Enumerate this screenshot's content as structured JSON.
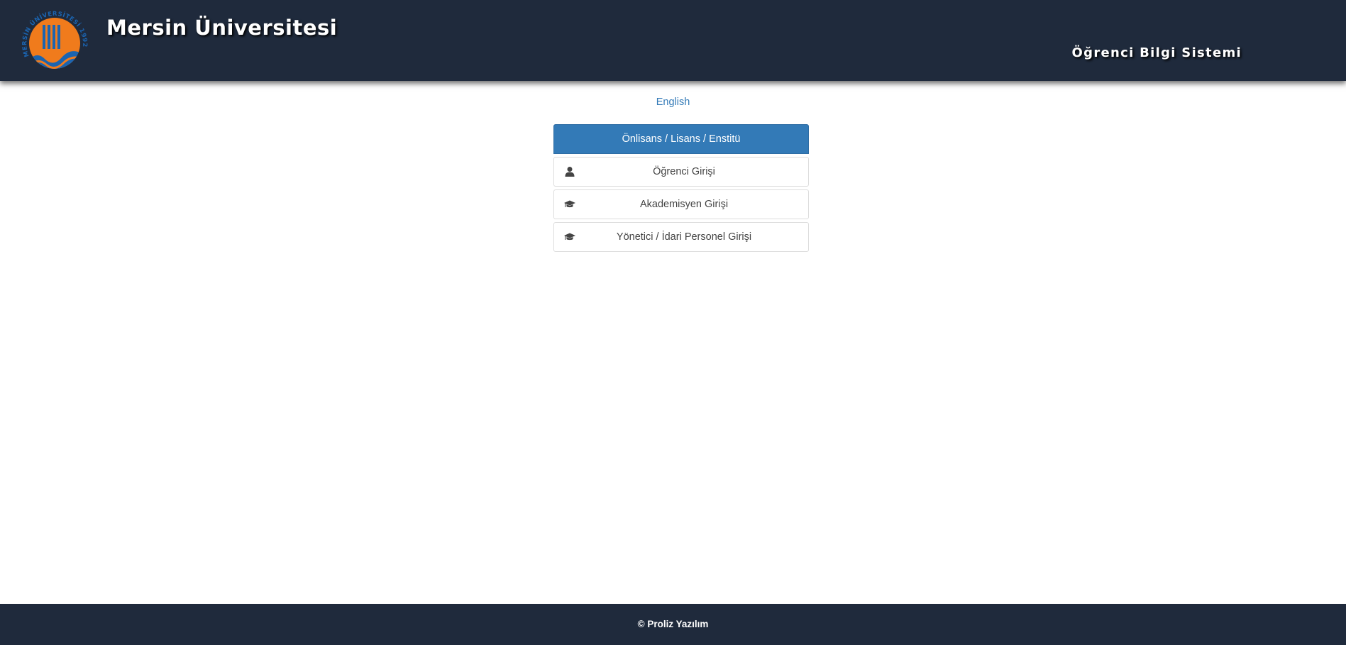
{
  "header": {
    "university_name": "Mersin Üniversitesi",
    "system_name": "Öğrenci Bilgi Sistemi",
    "logo_ring_text": "MERSİN ÜNİVERSİTESİ 1992",
    "colors": {
      "background": "#1f2a3c",
      "logo_orange": "#f07b1c",
      "logo_blue": "#1b64b0"
    }
  },
  "language_link": "English",
  "login_panel": {
    "heading": "Önlisans / Lisans / Enstitü",
    "buttons": [
      {
        "label": "Öğrenci Girişi",
        "icon": "user-icon"
      },
      {
        "label": "Akademisyen Girişi",
        "icon": "graduation-cap-icon"
      },
      {
        "label": "Yönetici / İdari Personel Girişi",
        "icon": "graduation-cap-icon"
      }
    ],
    "colors": {
      "heading_bg": "#337ab7",
      "button_border": "#dddddd",
      "text": "#444444"
    }
  },
  "footer": {
    "copyright": "© Proliz Yazılım"
  }
}
